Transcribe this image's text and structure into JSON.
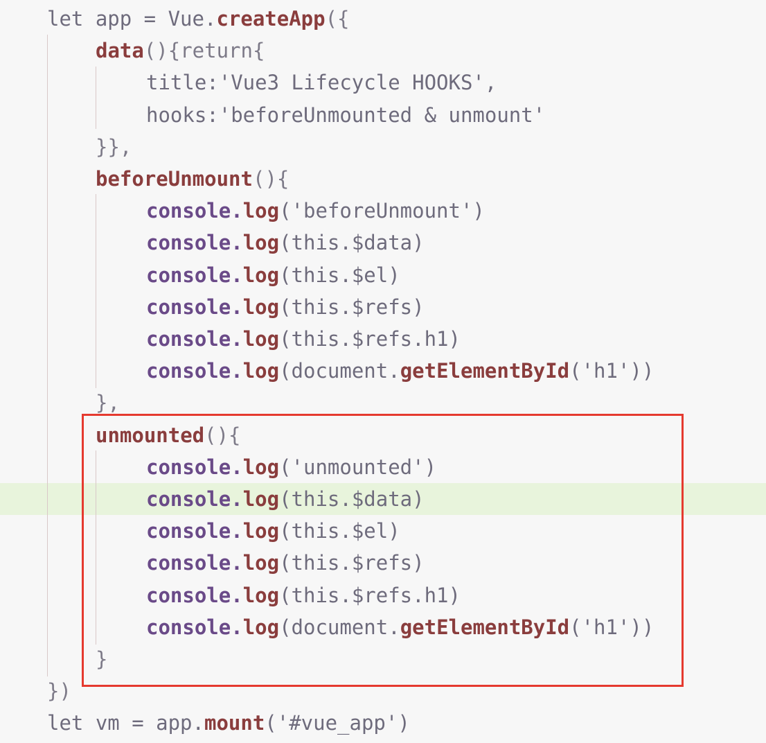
{
  "editor": {
    "language": "javascript",
    "highlighted_line": 15,
    "lines": [
      {
        "tokens": [
          {
            "t": "let app = Vue.",
            "k": "plain"
          },
          {
            "t": "createApp",
            "k": "method"
          },
          {
            "t": "({",
            "k": "punct"
          }
        ]
      },
      {
        "tokens": [
          {
            "t": "data",
            "k": "method"
          },
          {
            "t": "(){return{",
            "k": "punct"
          }
        ]
      },
      {
        "tokens": [
          {
            "t": "title:'Vue3 Lifecycle HOOKS',",
            "k": "string"
          }
        ]
      },
      {
        "tokens": [
          {
            "t": "hooks:'beforeUnmounted & unmount'",
            "k": "string"
          }
        ]
      },
      {
        "tokens": [
          {
            "t": "}},",
            "k": "punct"
          }
        ]
      },
      {
        "tokens": [
          {
            "t": "beforeUnmount",
            "k": "method"
          },
          {
            "t": "(){",
            "k": "punct"
          }
        ]
      },
      {
        "tokens": [
          {
            "t": "console.",
            "k": "console"
          },
          {
            "t": "log",
            "k": "method"
          },
          {
            "t": "('beforeUnmount')",
            "k": "string"
          }
        ]
      },
      {
        "tokens": [
          {
            "t": "console.",
            "k": "console"
          },
          {
            "t": "log",
            "k": "method"
          },
          {
            "t": "(this.$data)",
            "k": "plain"
          }
        ]
      },
      {
        "tokens": [
          {
            "t": "console.",
            "k": "console"
          },
          {
            "t": "log",
            "k": "method"
          },
          {
            "t": "(this.$el)",
            "k": "plain"
          }
        ]
      },
      {
        "tokens": [
          {
            "t": "console.",
            "k": "console"
          },
          {
            "t": "log",
            "k": "method"
          },
          {
            "t": "(this.$refs)",
            "k": "plain"
          }
        ]
      },
      {
        "tokens": [
          {
            "t": "console.",
            "k": "console"
          },
          {
            "t": "log",
            "k": "method"
          },
          {
            "t": "(this.$refs.h1)",
            "k": "plain"
          }
        ]
      },
      {
        "tokens": [
          {
            "t": "console.",
            "k": "console"
          },
          {
            "t": "log",
            "k": "method"
          },
          {
            "t": "(document.",
            "k": "plain"
          },
          {
            "t": "getElementById",
            "k": "method"
          },
          {
            "t": "('h1'))",
            "k": "string"
          }
        ]
      },
      {
        "tokens": [
          {
            "t": "},",
            "k": "punct"
          }
        ]
      },
      {
        "tokens": [
          {
            "t": "unmounted",
            "k": "method"
          },
          {
            "t": "(){",
            "k": "punct"
          }
        ]
      },
      {
        "tokens": [
          {
            "t": "console.",
            "k": "console"
          },
          {
            "t": "log",
            "k": "method"
          },
          {
            "t": "('unmounted')",
            "k": "string"
          }
        ]
      },
      {
        "tokens": [
          {
            "t": "console.",
            "k": "console"
          },
          {
            "t": "log",
            "k": "method"
          },
          {
            "t": "(this.$data)",
            "k": "plain"
          }
        ]
      },
      {
        "tokens": [
          {
            "t": "console.",
            "k": "console"
          },
          {
            "t": "log",
            "k": "method"
          },
          {
            "t": "(this.$el)",
            "k": "plain"
          }
        ]
      },
      {
        "tokens": [
          {
            "t": "console.",
            "k": "console"
          },
          {
            "t": "log",
            "k": "method"
          },
          {
            "t": "(this.$refs)",
            "k": "plain"
          }
        ]
      },
      {
        "tokens": [
          {
            "t": "console.",
            "k": "console"
          },
          {
            "t": "log",
            "k": "method"
          },
          {
            "t": "(this.$refs.h1)",
            "k": "plain"
          }
        ]
      },
      {
        "tokens": [
          {
            "t": "console.",
            "k": "console"
          },
          {
            "t": "log",
            "k": "method"
          },
          {
            "t": "(document.",
            "k": "plain"
          },
          {
            "t": "getElementById",
            "k": "method"
          },
          {
            "t": "('h1'))",
            "k": "string"
          }
        ]
      },
      {
        "tokens": [
          {
            "t": "}",
            "k": "punct"
          }
        ]
      },
      {
        "tokens": [
          {
            "t": "})",
            "k": "punct"
          }
        ]
      },
      {
        "tokens": [
          {
            "t": "let vm = app.",
            "k": "plain"
          },
          {
            "t": "mount",
            "k": "method"
          },
          {
            "t": "('#vue_app')",
            "k": "string"
          }
        ]
      }
    ]
  },
  "annotation": {
    "color": "#e53a2f",
    "label": "selection-box around unmounted hook"
  }
}
